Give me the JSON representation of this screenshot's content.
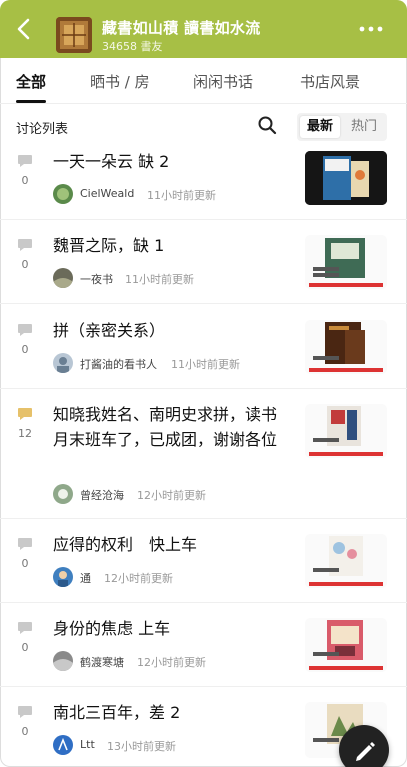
{
  "header": {
    "title": "藏書如山積 讀書如水流",
    "subtitle": "34658 書友"
  },
  "tabs": [
    {
      "label": "全部"
    },
    {
      "label": "晒书 / 房"
    },
    {
      "label": "闲闲书话"
    },
    {
      "label": "书店风景"
    }
  ],
  "list": {
    "title": "讨论列表",
    "sort_latest": "最新",
    "sort_hot": "热门"
  },
  "posts": [
    {
      "count": "0",
      "title": "一天一朵云 缺 2",
      "author": "CielWeald",
      "time": "11小时前更新"
    },
    {
      "count": "0",
      "title": "魏晋之际，缺 1",
      "author": "一夜书",
      "time": "11小时前更新"
    },
    {
      "count": "0",
      "title": "拼（亲密关系）",
      "author": "打酱油的看书人",
      "time": "11小时前更新"
    },
    {
      "count": "12",
      "title": "知晓我姓名、南明史求拼，读书月末班车了，已成团，谢谢各位",
      "author": "曾经沧海",
      "time": "12小时前更新"
    },
    {
      "count": "0",
      "title": "应得的权利　快上车",
      "author": "通",
      "time": "12小时前更新"
    },
    {
      "count": "0",
      "title": "身份的焦虑 上车",
      "author": "鹤渡寒塘",
      "time": "12小时前更新"
    },
    {
      "count": "0",
      "title": "南北三百年，差 2",
      "author": "Ltt",
      "time": "13小时前更新"
    }
  ],
  "colors": {
    "header_bg": "#a7bf45",
    "comment_icon": "#c9c9c9",
    "comment_icon_active": "#e6c16a"
  }
}
